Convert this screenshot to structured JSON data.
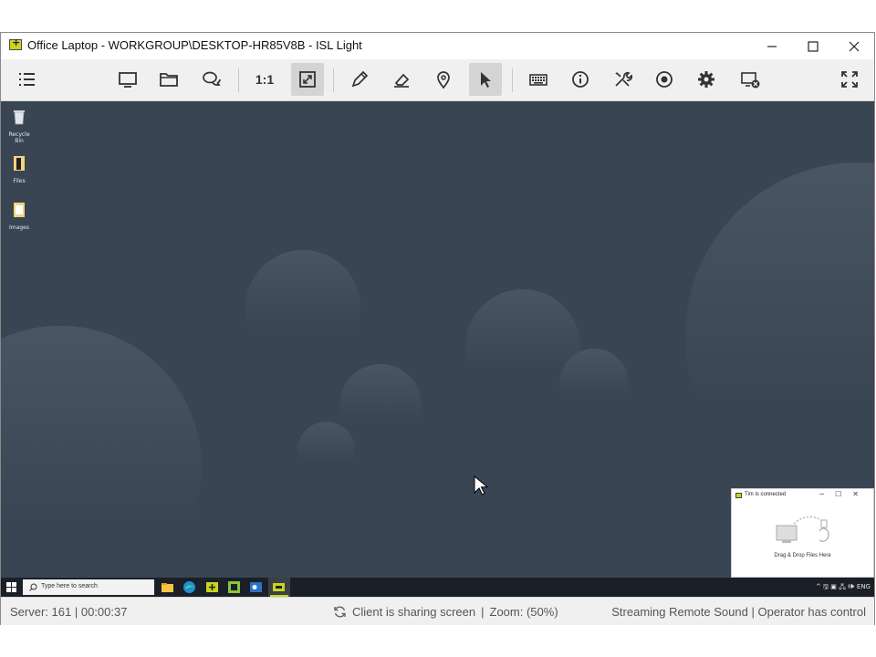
{
  "window": {
    "title": "Office Laptop - WORKGROUP\\DESKTOP-HR85V8B - ISL Light",
    "minimize": "─",
    "maximize": "☐",
    "close": "✕"
  },
  "toolbar": {
    "ratio_label": "1:1",
    "buttons": [
      "menu-icon",
      "monitor-icon",
      "folder-icon",
      "chat-icon",
      "one-to-one",
      "fit-screen-icon",
      "pen-icon",
      "eraser-icon",
      "pin-icon",
      "pointer-icon",
      "keyboard-icon",
      "info-icon",
      "tools-icon",
      "record-icon",
      "settings-icon",
      "disconnect-icon",
      "fullscreen-icon"
    ],
    "active": [
      "fit-screen-icon",
      "pointer-icon"
    ]
  },
  "desktop": {
    "icons": [
      {
        "label": "Recycle Bin",
        "icon": "recycle-bin-icon"
      },
      {
        "label": "Files",
        "icon": "file-icon"
      },
      {
        "label": "Images",
        "icon": "file-icon"
      }
    ],
    "background_color": "#3a4553"
  },
  "notification": {
    "title": "Tim  is connected",
    "drop_text": "Drag & Drop Files Here"
  },
  "taskbar": {
    "search_placeholder": "Type here to search",
    "tray_text": "^ 🖫 ▣ 🖧 🕪  ENG"
  },
  "status": {
    "server": "Server: 161",
    "time": "00:00:37",
    "sharing": "Client is sharing screen",
    "zoom": "Zoom: (50%)",
    "sound": "Streaming Remote Sound",
    "control": "Operator has control",
    "separator": "|"
  },
  "colors": {
    "accent": "#c9d41f",
    "desktop": "#3a4553",
    "taskbar": "#1b1f27",
    "toolbar": "#f0f0f0"
  }
}
